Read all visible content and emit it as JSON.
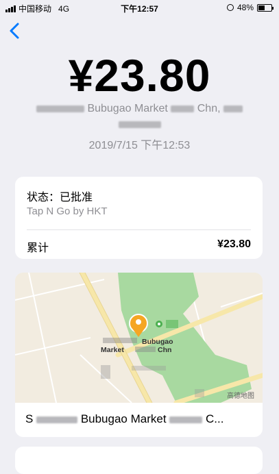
{
  "status_bar": {
    "carrier": "中国移动",
    "network": "4G",
    "time": "下午12:57",
    "battery_percent": "48%",
    "battery_level": 0.48
  },
  "transaction": {
    "amount": "¥23.80",
    "merchant_visible": "Bubugao Market",
    "merchant_suffix": "Chn, ",
    "datetime": "2019/7/15 下午12:53"
  },
  "details": {
    "status": "状态：已批准",
    "payment_network": "Tap N Go by HKT",
    "total_label": "累计",
    "total_value": "¥23.80"
  },
  "map": {
    "poi_label_line1": "Bubugao",
    "poi_label_line2_left": "Market",
    "poi_label_line2_right": "Chn",
    "attribution": "高德地图",
    "caption_left": "S",
    "caption_main": "Bubugao Market",
    "caption_right": "C..."
  },
  "colors": {
    "accent": "#007aff",
    "secondary_text": "#8e8e93",
    "map_park": "#a8d9a0",
    "map_road": "#f7e7a9",
    "pin": "#f5a623"
  }
}
